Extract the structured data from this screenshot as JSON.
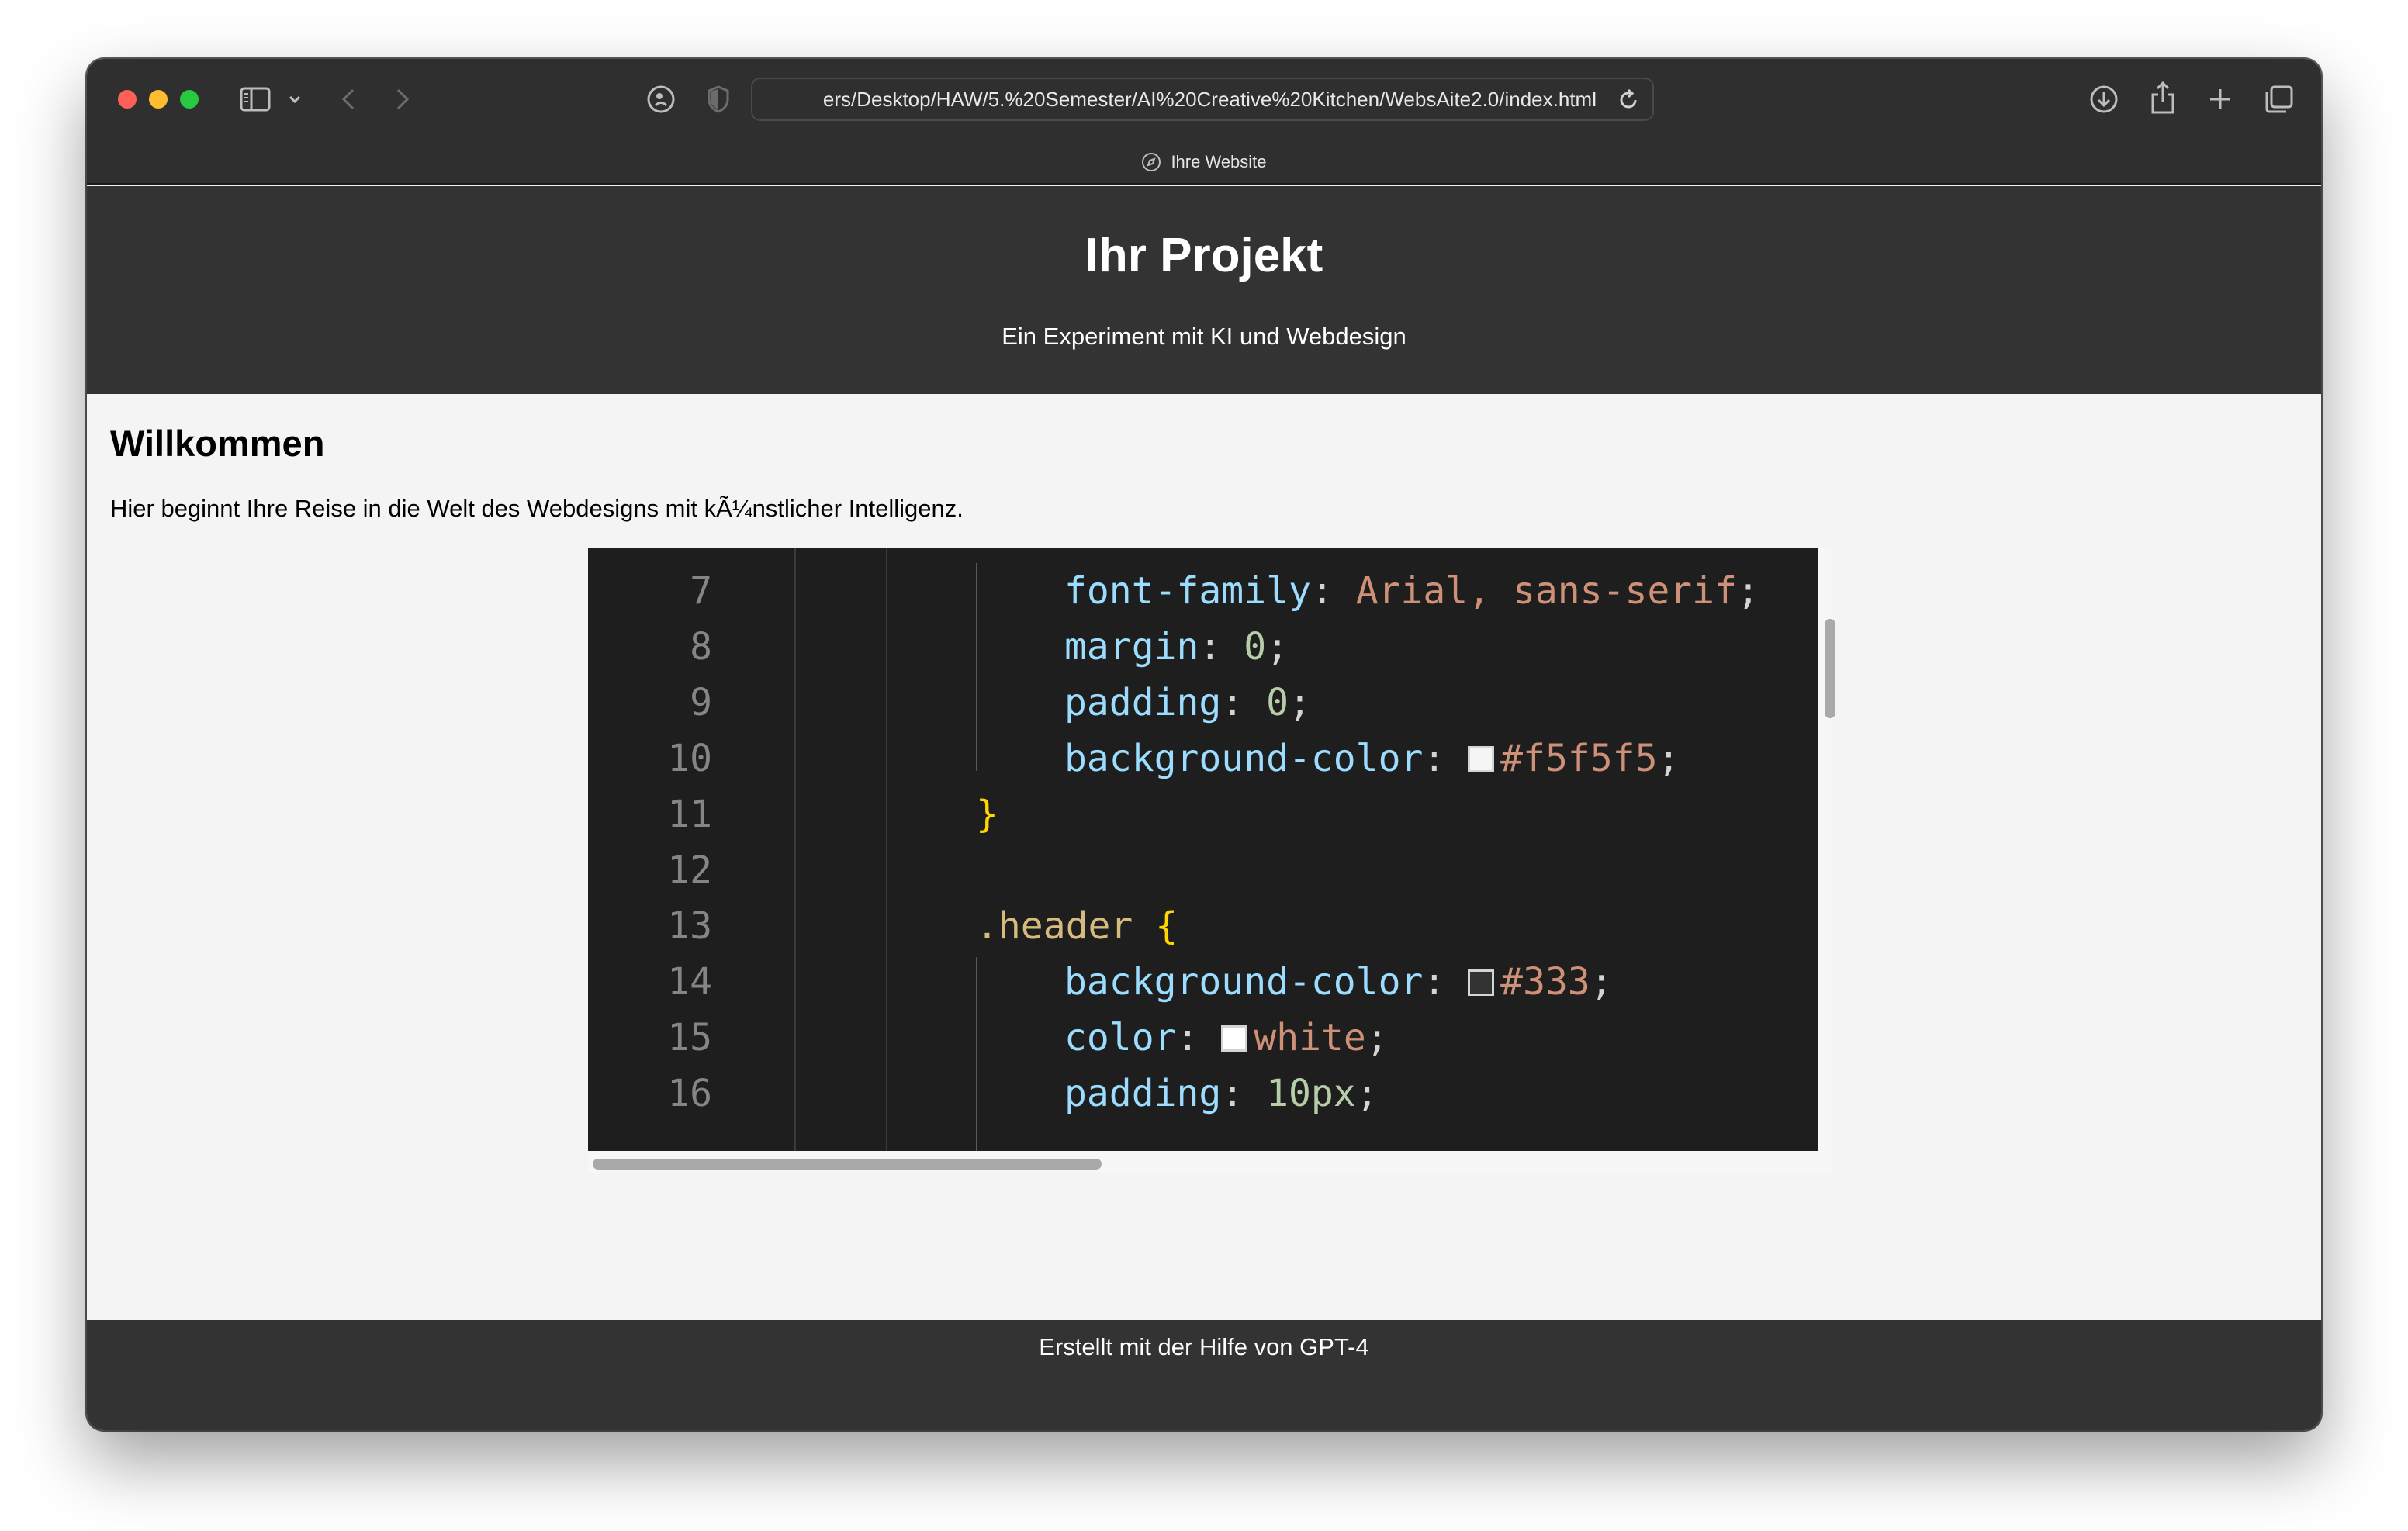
{
  "browser": {
    "url": "ers/Desktop/HAW/5.%20Semester/AI%20Creative%20Kitchen/WebsAite2.0/index.html",
    "tab_title": "Ihre Website",
    "icons": [
      "close-button",
      "minimize-button",
      "zoom-button",
      "sidebar-icon",
      "chevron-down-icon",
      "back-arrow-icon",
      "forward-arrow-icon",
      "duckduckgo-icon",
      "privacy-shield-icon",
      "reload-icon",
      "download-icon",
      "share-icon",
      "plus-icon",
      "tabs-overview-icon",
      "compass-icon"
    ]
  },
  "header": {
    "title": "Ihr Projekt",
    "subtitle": "Ein Experiment mit KI und Webdesign"
  },
  "main": {
    "heading": "Willkommen",
    "intro": "Hier beginnt Ihre Reise in die Welt des Webdesigns mit kÃ¼nstlicher Intelligenz."
  },
  "code_image": {
    "lines": [
      {
        "num": "7",
        "prop": "font-family",
        "value": "Arial, sans-serif"
      },
      {
        "num": "8",
        "prop": "margin",
        "value": "0"
      },
      {
        "num": "9",
        "prop": "padding",
        "value": "0"
      },
      {
        "num": "10",
        "prop": "background-color",
        "value": "#f5f5f5",
        "swatch": "#f5f5f5"
      },
      {
        "num": "11",
        "text": "}"
      },
      {
        "num": "12",
        "text": ""
      },
      {
        "num": "13",
        "selector": ".header",
        "brace": "{"
      },
      {
        "num": "14",
        "prop": "background-color",
        "value": "#333",
        "swatch": "#333333"
      },
      {
        "num": "15",
        "prop": "color",
        "value": "white",
        "swatch": "#ffffff"
      },
      {
        "num": "16",
        "prop": "padding",
        "value": "10px"
      }
    ]
  },
  "footer": {
    "text": "Erstellt mit der Hilfe von GPT-4"
  },
  "colors": {
    "header_bg": "#333333",
    "page_bg": "#f4f4f4",
    "code_bg": "#1e1e1e",
    "titlebar_bg": "#2f2f2f"
  }
}
